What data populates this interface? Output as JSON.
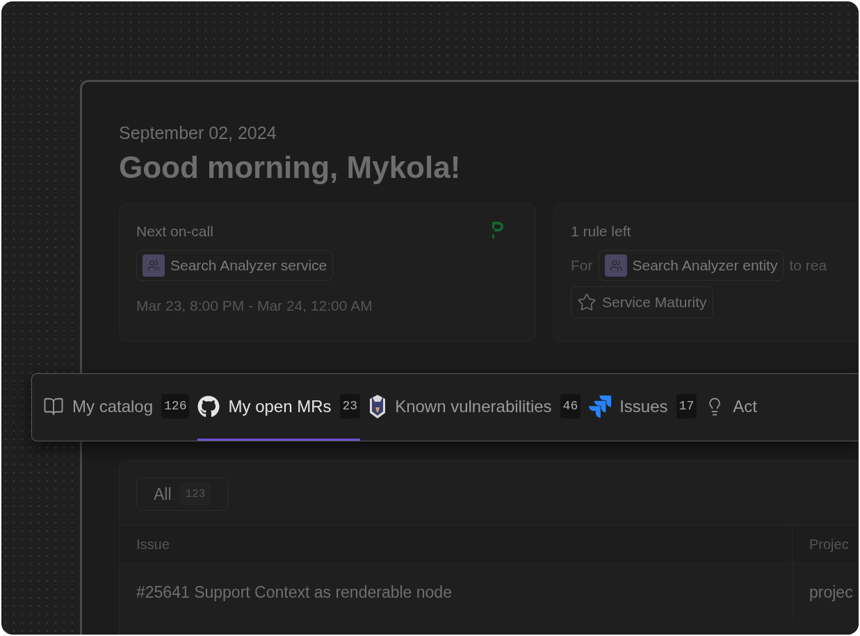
{
  "date": "September 02, 2024",
  "greeting": "Good morning, Mykola!",
  "oncall": {
    "title": "Next on-call",
    "entity": "Search Analyzer service",
    "time": "Mar 23, 8:00 PM - Mar 24, 12:00 AM"
  },
  "rule": {
    "title": "1 rule left",
    "prefix": "For",
    "entity": "Search Analyzer entity",
    "suffix": "to rea",
    "scorecard": "Service Maturity"
  },
  "tabs": [
    {
      "kind": "book",
      "label": "My catalog",
      "count": "126",
      "selected": false
    },
    {
      "kind": "github",
      "label": "My open MRs",
      "count": "23",
      "selected": true
    },
    {
      "kind": "dog",
      "label": "Known vulnerabilities",
      "count": "46",
      "selected": false
    },
    {
      "kind": "jira",
      "label": "Issues",
      "count": "17",
      "selected": false
    },
    {
      "kind": "bulb",
      "label": "Act",
      "selected": false
    }
  ],
  "filter": {
    "label": "All",
    "count": "123"
  },
  "table": {
    "columns": [
      "Issue",
      "Projec"
    ],
    "rows": [
      [
        "#25641 Support Context as renderable node",
        "projec"
      ]
    ]
  }
}
